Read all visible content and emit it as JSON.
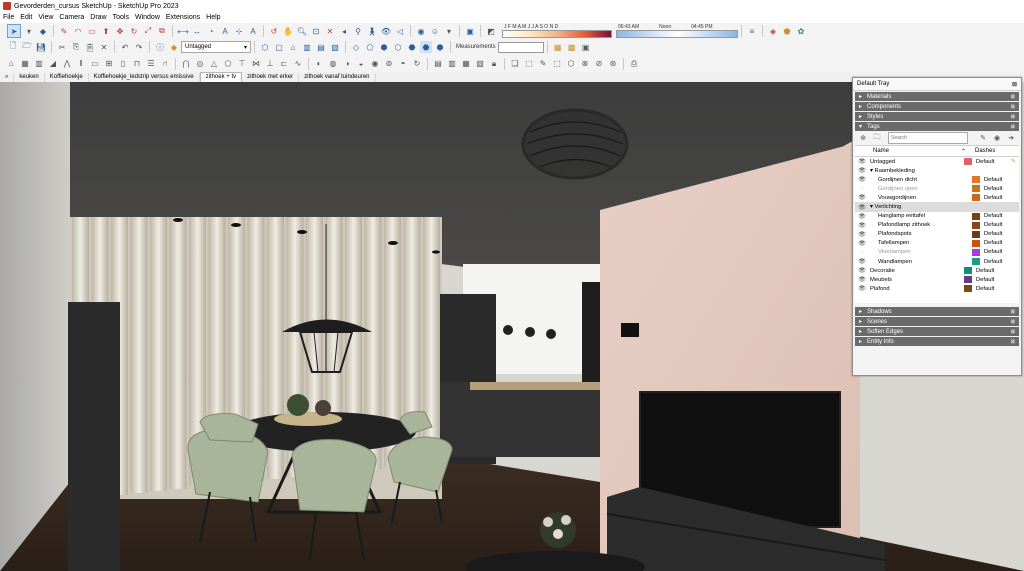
{
  "window": {
    "title": "Gevorderden_cursus SketchUp - SketchUp Pro 2023"
  },
  "menu": [
    "File",
    "Edit",
    "View",
    "Camera",
    "Draw",
    "Tools",
    "Window",
    "Extensions",
    "Help"
  ],
  "toolbar": {
    "tag_select": "Untagged",
    "months": "J F M A M J J A S O N D",
    "time_start": "06:43 AM",
    "time_noon": "Noon",
    "time_end": "04:45 PM",
    "measurements_label": "Measurements",
    "measurements_value": ""
  },
  "scenes": {
    "search_icon": "search-icon",
    "tabs": [
      "keuken",
      "Koffiehoekje",
      "Koffiehoekje_ledstrip versus emissive",
      "zithoek + tv",
      "zithoek met erker",
      "zithoek vanaf tuindeuren"
    ],
    "active_index": 3
  },
  "tray": {
    "title": "Default Tray",
    "collapsed_top": [
      "Materials",
      "Components",
      "Styles"
    ],
    "tags_panel": {
      "title": "Tags",
      "search_placeholder": "Search",
      "col_name": "Name",
      "col_dashes": "Dashes",
      "rows": [
        {
          "name": "Untagged",
          "visible": true,
          "color": "#e0636b",
          "dashes": "Default",
          "level": 0,
          "highlight": false,
          "active": true
        },
        {
          "name": "▾ Raambekleding",
          "visible": true,
          "color": "",
          "dashes": "",
          "level": 0,
          "highlight": false,
          "active": false
        },
        {
          "name": "Gordijnen dicht",
          "visible": true,
          "color": "#e07a1c",
          "dashes": "Default",
          "level": 2,
          "highlight": false,
          "active": false
        },
        {
          "name": "Gordijnen open",
          "visible": false,
          "color": "#c0761d",
          "dashes": "Default",
          "level": 2,
          "highlight": false,
          "active": false
        },
        {
          "name": "Vouwgordijnen",
          "visible": true,
          "color": "#c86a1a",
          "dashes": "Default",
          "level": 2,
          "highlight": false,
          "active": false
        },
        {
          "name": "▾ Verlichting",
          "visible": true,
          "color": "",
          "dashes": "",
          "level": 0,
          "highlight": true,
          "active": false
        },
        {
          "name": "Hanglamp eettafel",
          "visible": true,
          "color": "#7a3e12",
          "dashes": "Default",
          "level": 2,
          "highlight": false,
          "active": false
        },
        {
          "name": "Plafondlamp zithoek",
          "visible": true,
          "color": "#8b4513",
          "dashes": "Default",
          "level": 2,
          "highlight": false,
          "active": false
        },
        {
          "name": "Plafondspots",
          "visible": true,
          "color": "#6b3b1a",
          "dashes": "Default",
          "level": 2,
          "highlight": false,
          "active": false
        },
        {
          "name": "Tafellampen",
          "visible": true,
          "color": "#c8540f",
          "dashes": "Default",
          "level": 2,
          "highlight": false,
          "active": false
        },
        {
          "name": "Vloerlampen",
          "visible": false,
          "color": "#b03ad1",
          "dashes": "Default",
          "level": 2,
          "highlight": false,
          "active": false
        },
        {
          "name": "Wandlampen",
          "visible": true,
          "color": "#1a9e8a",
          "dashes": "Default",
          "level": 2,
          "highlight": false,
          "active": false
        },
        {
          "name": "Decoratie",
          "visible": true,
          "color": "#0f8f7a",
          "dashes": "Default",
          "level": 0,
          "highlight": false,
          "active": false
        },
        {
          "name": "Meubels",
          "visible": true,
          "color": "#6a3a8a",
          "dashes": "Default",
          "level": 0,
          "highlight": false,
          "active": false
        },
        {
          "name": "Plafond",
          "visible": true,
          "color": "#7a4a14",
          "dashes": "Default",
          "level": 0,
          "highlight": false,
          "active": false
        }
      ]
    },
    "collapsed_bottom": [
      "Shadows",
      "Scenes",
      "Soften Edges",
      "Entity Info"
    ]
  }
}
